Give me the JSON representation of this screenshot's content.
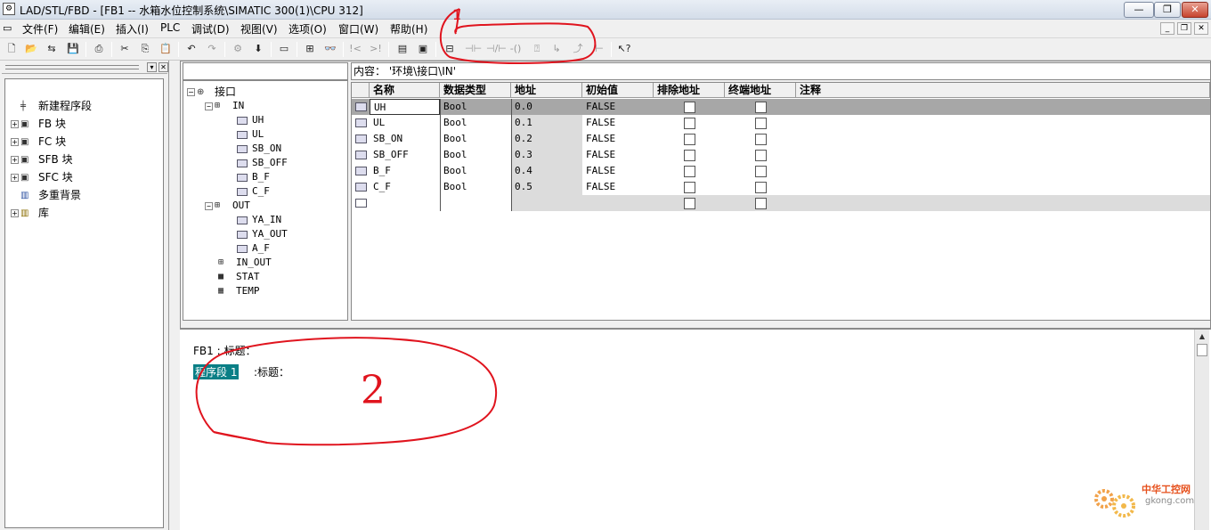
{
  "window": {
    "title": "LAD/STL/FBD  - [FB1 -- 水箱水位控制系统\\SIMATIC 300(1)\\CPU 312]",
    "app_icon": "step7-app-icon",
    "min_label": "—",
    "max_label": "❐",
    "close_label": "✕"
  },
  "menu": {
    "items": [
      "文件(F)",
      "编辑(E)",
      "插入(I)",
      "PLC",
      "调试(D)",
      "视图(V)",
      "选项(O)",
      "窗口(W)",
      "帮助(H)"
    ],
    "mdi": [
      "_",
      "❐",
      "✕"
    ]
  },
  "left_tree": {
    "items": [
      {
        "label": "新建程序段",
        "icon": "new-network-icon",
        "expand": ""
      },
      {
        "label": "FB 块",
        "icon": "block-icon",
        "expand": "+"
      },
      {
        "label": "FC 块",
        "icon": "block-icon",
        "expand": "+"
      },
      {
        "label": "SFB 块",
        "icon": "block-icon",
        "expand": "+"
      },
      {
        "label": "SFC 块",
        "icon": "block-icon",
        "expand": "+"
      },
      {
        "label": "多重背景",
        "icon": "multi-instance-icon",
        "expand": ""
      },
      {
        "label": "库",
        "icon": "library-icon",
        "expand": "+"
      }
    ]
  },
  "interface_tree": {
    "root": "接口",
    "in": "IN",
    "in_items": [
      "UH",
      "UL",
      "SB_ON",
      "SB_OFF",
      "B_F",
      "C_F"
    ],
    "out": "OUT",
    "out_items": [
      "YA_IN",
      "YA_OUT",
      "A_F"
    ],
    "in_out": "IN_OUT",
    "stat": "STAT",
    "temp": "TEMP"
  },
  "content_path": "内容：  '环境\\接口\\IN'",
  "table": {
    "headers": [
      "名称",
      "数据类型",
      "地址",
      "初始值",
      "排除地址",
      "终端地址",
      "注释"
    ],
    "rows": [
      {
        "name": "UH",
        "type": "Bool",
        "address": "0.0",
        "initial": "FALSE"
      },
      {
        "name": "UL",
        "type": "Bool",
        "address": "0.1",
        "initial": "FALSE"
      },
      {
        "name": "SB_ON",
        "type": "Bool",
        "address": "0.2",
        "initial": "FALSE"
      },
      {
        "name": "SB_OFF",
        "type": "Bool",
        "address": "0.3",
        "initial": "FALSE"
      },
      {
        "name": "B_F",
        "type": "Bool",
        "address": "0.4",
        "initial": "FALSE"
      },
      {
        "name": "C_F",
        "type": "Bool",
        "address": "0.5",
        "initial": "FALSE"
      }
    ]
  },
  "editor": {
    "fb_title": "FB1 : 标题：",
    "network_label": "程序段 1",
    "network_title": ":标题："
  },
  "annotations": {
    "one": "1",
    "two": "2",
    "color": "#e0141e"
  },
  "watermark": {
    "cn": "中华工控网",
    "en": "gkong.com"
  }
}
